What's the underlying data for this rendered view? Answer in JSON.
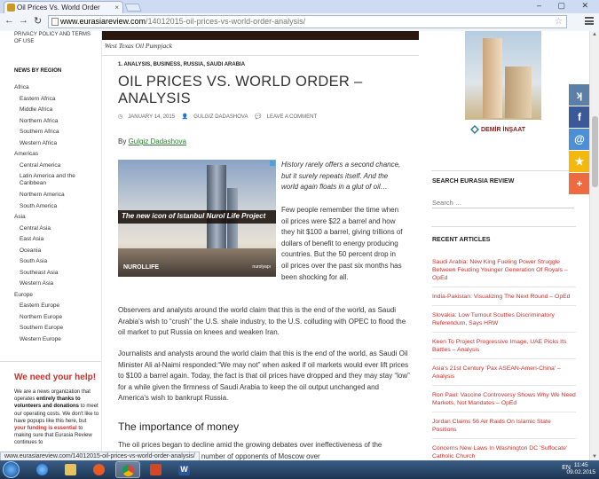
{
  "browser": {
    "tab_title": "Oil Prices Vs. World Order",
    "tab_close": "×",
    "window_controls": "– ▢ ✕",
    "nav_back": "←",
    "nav_forward": "→",
    "nav_reload": "↻",
    "url_host": "www.eurasiareview.com",
    "url_path": "/14012015-oil-prices-vs-world-order-analysis/",
    "star": "☆",
    "status_url": "www.eurasiareview.com/14012015-oil-prices-vs-world-order-analysis/"
  },
  "left_sidebar": {
    "privacy": "PRIVACY POLICY AND TERMS OF USE",
    "news_by_region": "NEWS BY REGION",
    "regions": [
      {
        "label": "Africa",
        "children": [
          "Eastern Africa",
          "Middle Africa",
          "Northern Africa",
          "Southern Africa",
          "Western Africa"
        ]
      },
      {
        "label": "Americas",
        "children": [
          "Central America",
          "Latin America and the Caribbean",
          "Northern America",
          "South America"
        ]
      },
      {
        "label": "Asia",
        "children": [
          "Central Asia",
          "East Asia",
          "Oceania",
          "South Asia",
          "Southeast Asia",
          "Western Asia"
        ]
      },
      {
        "label": "Europe",
        "children": [
          "Eastern Europe",
          "Northern Europe",
          "Southern Europe",
          "Western Europe"
        ]
      }
    ],
    "help_title": "We need your help!",
    "help_text_1": "We are a news organization that operates ",
    "help_text_bold": "entirely thanks to volunteers and donations",
    "help_text_2": " to meet our operating costs. We don't like to have popups like this here, but ",
    "help_text_red": "your funding is essential",
    "help_text_3": " to making sure that Eurasia Review continues to"
  },
  "article": {
    "image_caption": "West Texas Oil Pumpjack",
    "categories": "1. ANALYSIS, BUSINESS, RUSSIA, SAUDI ARABIA",
    "title": "OIL PRICES VS. WORLD ORDER – ANALYSIS",
    "date": "JANUARY 14, 2015",
    "author_meta": "GULGIZ DADASHOVA",
    "comment": "LEAVE A COMMENT",
    "by": "By ",
    "author": "Gulgiz Dadashova",
    "lede": "History rarely offers a second chance, but it surely repeats itself. And the world again floats in a glut of oil…",
    "para1": "Few people remember the time when oil prices were $22 a barrel and how they hit $100 a barrel, giving trillions of dollars of benefit to energy producing countries. But the 50 percent drop in oil prices over the past six months has been shocking for all.",
    "para2": "Observers and analysts around the world claim that this is the end of the world, as Saudi Arabia's wish to “crush” the U.S. shale industry, to the U.S. colluding with OPEC to flood the oil market to put Russia on knees and weaken Iran.",
    "para3": "Journalists and analysts around the world claim that this is the end of the world, as Saudi Oil Minister Ali al-Naimi responded:“We may not” when asked if oil markets would ever lift prices to $100 a barrel again. Today, the fact is that oil prices have dropped and they may stay “low” for a while given the firmness of Saudi Arabia to keep the oil output unchanged and America's wish to bankrupt Russia.",
    "heading": "The importance of money",
    "para4": "The oil prices began to decline amid the growing debates over ineffectiveness of the sanctions inside the rising number of opponents of Moscow over"
  },
  "inline_ad": {
    "headline": "The new icon of Istanbul Nurol Life Project",
    "logo": "NUROLLIFE",
    "logo2": "nurolyapı"
  },
  "right_sidebar": {
    "ad_brand": "DEMİR İNŞAAT",
    "search_title": "SEARCH EURASIA REVIEW",
    "search_placeholder": "Search …",
    "recent_title": "RECENT ARTICLES",
    "recent": [
      "Saudi Arabia: New King Fueling Power Struggle Between Feuding Younger Generation Of Royals – OpEd",
      "India-Pakistan: Visualizing The Next Round – OpEd",
      "Slovakia: Low Turnout Scuttles Discriminatory Referendum, Says HRW",
      "Keen To Project Progressive Image, UAE Picks Its Battles – Analysis",
      "Asia's 21st Century 'Pax ASEAN-Ameri-China' – Analysis",
      "Ron Paul: Vaccine Controversy Shows Why We Need Markets, Not Mandates – OpEd",
      "Jordan Claims 56 Air Raids On Islamic State Positions",
      "Concerns New Laws In Washington DC 'Suffocate' Catholic Church"
    ]
  },
  "share": [
    "ʞ",
    "f",
    "@",
    "★",
    "+"
  ],
  "taskbar": {
    "lang": "EN",
    "time": "11:45",
    "date": "09.02.2015",
    "word_icon": "W"
  }
}
